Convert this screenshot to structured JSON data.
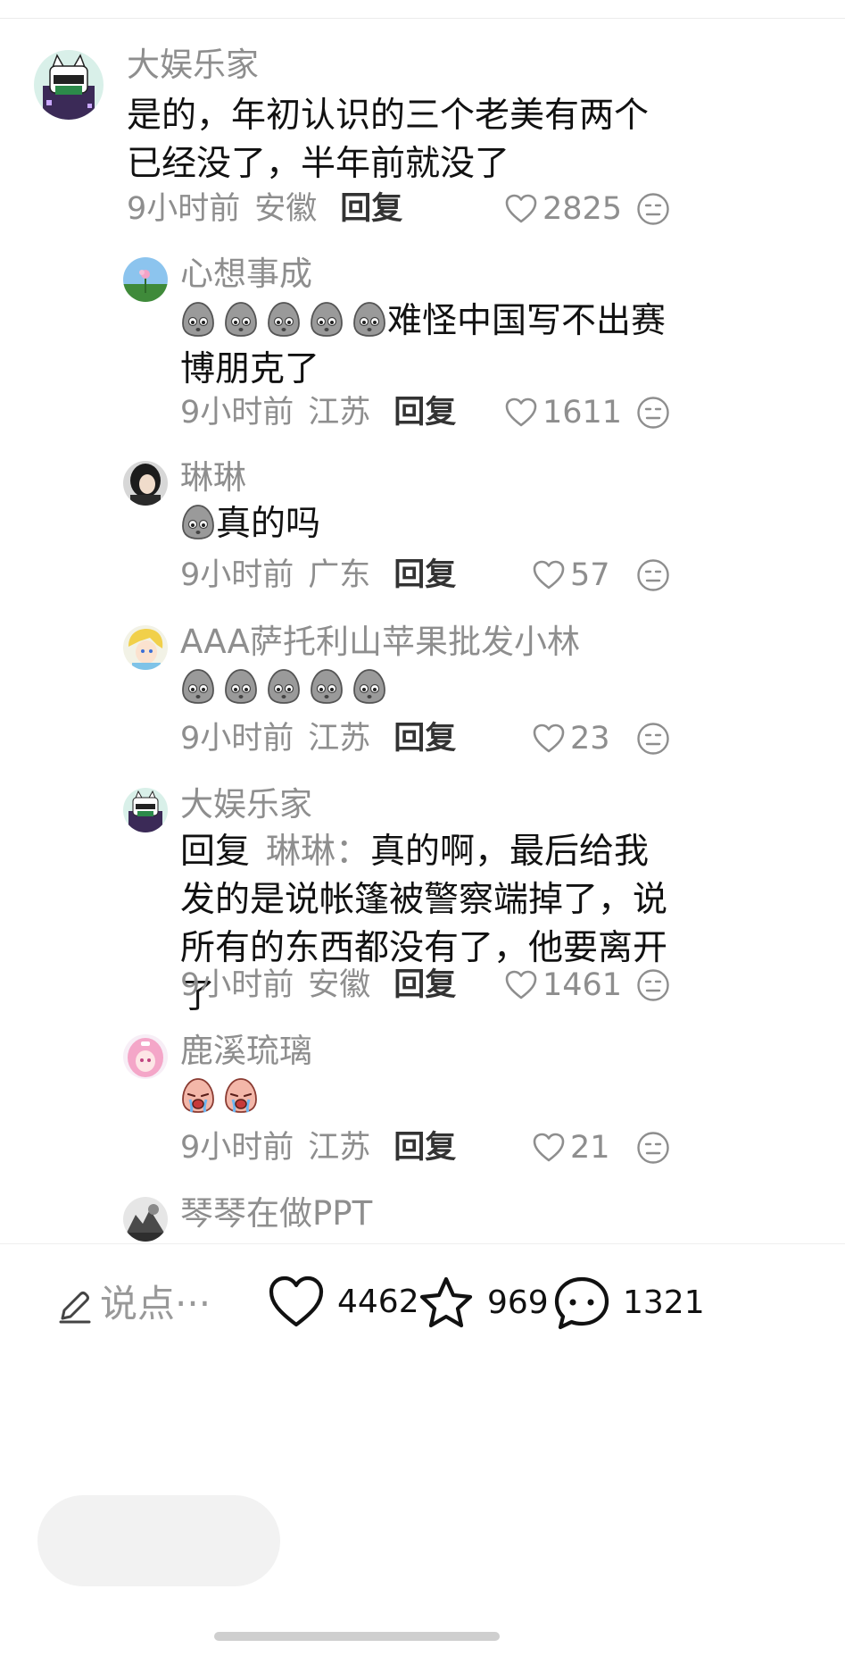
{
  "comments": [
    {
      "username": "大娱乐家",
      "text": "是的，年初认识的三个老美有两个已经没了，半年前就没了",
      "time": "9小时前",
      "location": "安徽",
      "reply_label": "回复",
      "likes": "2825"
    },
    {
      "username": "心想事成",
      "text": "难怪中国写不出赛博朋克了",
      "time": "9小时前",
      "location": "江苏",
      "reply_label": "回复",
      "likes": "1611"
    },
    {
      "username": "琳琳",
      "text": "真的吗",
      "time": "9小时前",
      "location": "广东",
      "reply_label": "回复",
      "likes": "57"
    },
    {
      "username": "AAA萨托利山苹果批发小林",
      "text": "",
      "time": "9小时前",
      "location": "江苏",
      "reply_label": "回复",
      "likes": "23"
    },
    {
      "username": "大娱乐家",
      "reply_prefix": "回复",
      "reply_target": "琳琳：",
      "text": "真的啊，最后给我发的是说帐篷被警察端掉了，说所有的东西都没有了，他要离开了",
      "time": "9小时前",
      "location": "安徽",
      "reply_label": "回复",
      "likes": "1461"
    },
    {
      "username": "鹿溪琉璃",
      "text": "",
      "time": "9小时前",
      "location": "江苏",
      "reply_label": "回复",
      "likes": "21"
    },
    {
      "username": "琴琴在做PPT"
    }
  ],
  "bottom_bar": {
    "input_placeholder": "说点···",
    "like_count": "4462",
    "favorite_count": "969",
    "comment_count": "1321"
  },
  "icons": {
    "like": "heart-outline-icon",
    "dislike": "meh-face-icon",
    "favorite": "star-outline-icon",
    "comment": "chat-bubble-icon",
    "edit": "pencil-icon",
    "emoji_gray": "gray-egg-emoji",
    "emoji_cry": "crying-emoji"
  }
}
